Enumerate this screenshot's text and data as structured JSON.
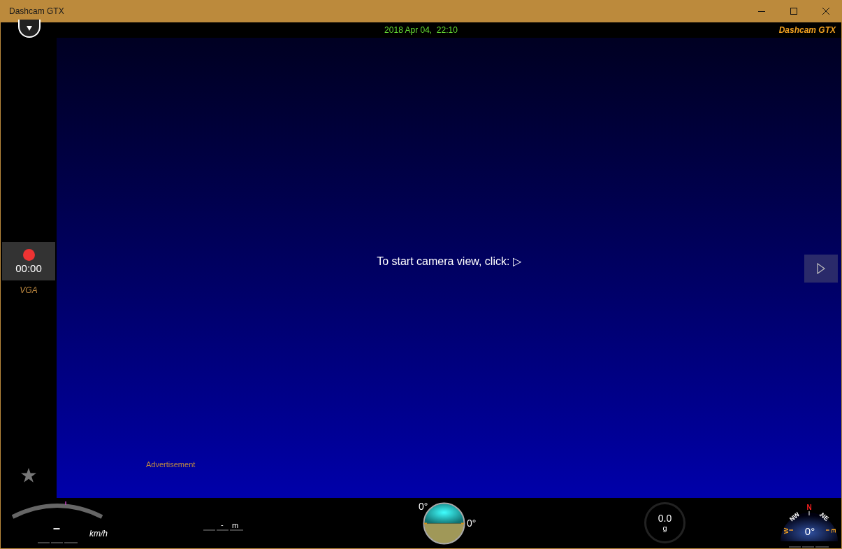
{
  "window": {
    "title": "Dashcam GTX"
  },
  "header": {
    "datetime": "2018 Apr 04,  22:10",
    "brand": "Dashcam GTX"
  },
  "recorder": {
    "recording_time": "00:00",
    "resolution": "VGA"
  },
  "camera_prompt": "To start camera view, click: ▷",
  "advertisement": "Advertisement",
  "speed": {
    "value": "–",
    "unit": "km/h"
  },
  "altitude": {
    "value": "-",
    "unit": "m"
  },
  "attitude": {
    "pitch": "0°",
    "roll": "0°"
  },
  "gforce": {
    "value": "0.0",
    "unit": "g"
  },
  "compass": {
    "heading": "0°",
    "north": "N",
    "northeast": "NE",
    "northwest": "NW",
    "east": "E",
    "west": "W"
  }
}
